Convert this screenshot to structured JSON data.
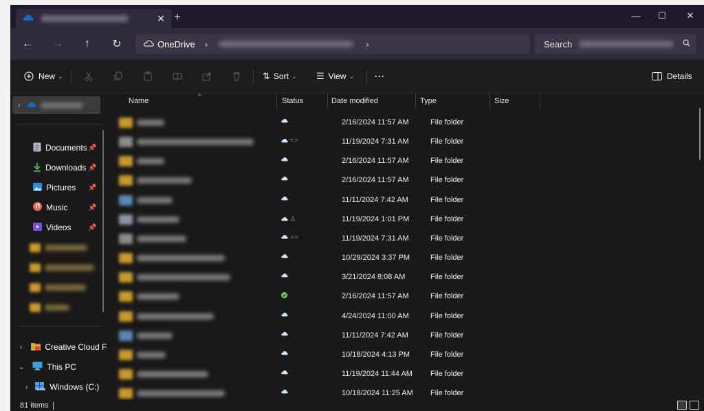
{
  "colors": {
    "accent": "#4cc2ff",
    "onedrive_blue": "#0f6cbd",
    "status_green": "#6ccb5f",
    "folder_yellow": "#d9a52a"
  },
  "titlebar": {
    "tab_close_glyph": "✕",
    "new_tab_glyph": "+",
    "minimize_glyph": "—",
    "maximize_glyph": "☐",
    "close_glyph": "✕"
  },
  "address": {
    "back_glyph": "←",
    "forward_glyph": "→",
    "up_glyph": "↑",
    "refresh_glyph": "↻",
    "root": "OneDrive",
    "separator": "›",
    "trailing_separator": "›"
  },
  "search": {
    "placeholder": "Search"
  },
  "toolbar": {
    "new_label": "New",
    "sort_label": "Sort",
    "view_label": "View",
    "more_label": "···",
    "details_label": "Details"
  },
  "sidebar": {
    "quick": [
      {
        "label": "Documents",
        "icon": "documents-icon"
      },
      {
        "label": "Downloads",
        "icon": "downloads-icon"
      },
      {
        "label": "Pictures",
        "icon": "pictures-icon"
      },
      {
        "label": "Music",
        "icon": "music-icon"
      },
      {
        "label": "Videos",
        "icon": "videos-icon"
      }
    ],
    "creative_cloud": "Creative Cloud F",
    "this_pc": "This PC",
    "windows_drive": "Windows (C:)"
  },
  "columns": {
    "name": "Name",
    "status": "Status",
    "date_modified": "Date modified",
    "type": "Type",
    "size": "Size"
  },
  "rows": [
    {
      "status": "cloud",
      "date": "2/16/2024 11:57 AM",
      "type": "File folder"
    },
    {
      "status": "cloud-shared",
      "date": "11/19/2024 7:31 AM",
      "type": "File folder"
    },
    {
      "status": "cloud",
      "date": "2/16/2024 11:57 AM",
      "type": "File folder"
    },
    {
      "status": "cloud",
      "date": "2/16/2024 11:57 AM",
      "type": "File folder"
    },
    {
      "status": "cloud",
      "date": "11/11/2024 7:42 AM",
      "type": "File folder"
    },
    {
      "status": "cloud-person",
      "date": "11/19/2024 1:01 PM",
      "type": "File folder"
    },
    {
      "status": "cloud-shared",
      "date": "11/19/2024 7:31 AM",
      "type": "File folder"
    },
    {
      "status": "cloud",
      "date": "10/29/2024 3:37 PM",
      "type": "File folder"
    },
    {
      "status": "cloud",
      "date": "3/21/2024 8:08 AM",
      "type": "File folder"
    },
    {
      "status": "synced",
      "date": "2/16/2024 11:57 AM",
      "type": "File folder"
    },
    {
      "status": "cloud",
      "date": "4/24/2024 11:00 AM",
      "type": "File folder"
    },
    {
      "status": "cloud",
      "date": "11/11/2024 7:42 AM",
      "type": "File folder"
    },
    {
      "status": "cloud",
      "date": "10/18/2024 4:13 PM",
      "type": "File folder"
    },
    {
      "status": "cloud",
      "date": "11/19/2024 11:44 AM",
      "type": "File folder"
    },
    {
      "status": "cloud",
      "date": "10/18/2024 11:25 AM",
      "type": "File folder"
    }
  ],
  "statusbar": {
    "item_count": "81 items"
  }
}
